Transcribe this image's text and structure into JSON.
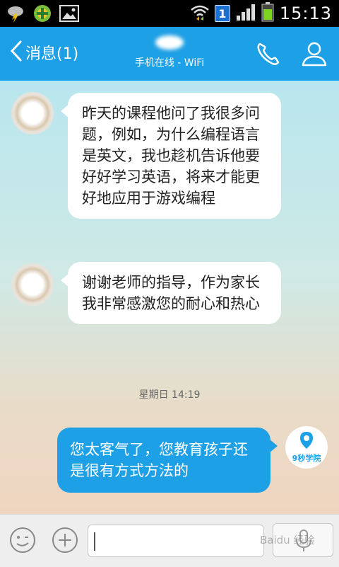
{
  "status_bar": {
    "time": "15:13",
    "notification_count": "1"
  },
  "header": {
    "back_label": "消息(1)",
    "contact_status": "手机在线 - WiFi"
  },
  "messages": [
    {
      "side": "left",
      "text": "昨天的课程他问了我很多问题，例如，为什么编程语言是英文，我也趁机告诉他要好好学习英语，将来才能更好地应用于游戏编程"
    },
    {
      "side": "left",
      "text": "谢谢老师的指导，作为家长我非常感激您的耐心和热心"
    },
    {
      "side": "time",
      "text": "星期日 14:19"
    },
    {
      "side": "right",
      "text": "您太客气了，您教育孩子还是很有方式方法的"
    }
  ],
  "self_avatar": {
    "logo_text": "9秒学院"
  },
  "watermark": "Baidu 经验",
  "colors": {
    "accent": "#1ea0e6"
  }
}
